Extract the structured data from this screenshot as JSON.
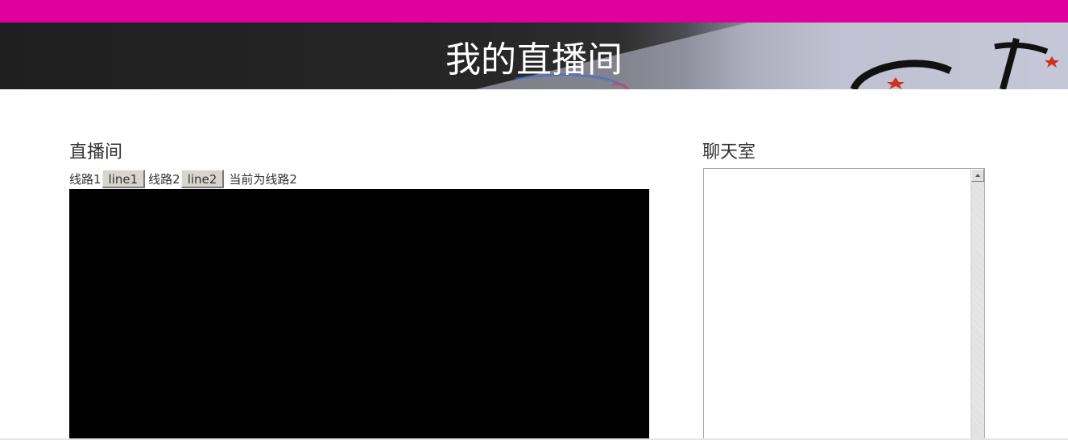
{
  "colors": {
    "topbar": "#e0009c",
    "banner_text": "#ffffff",
    "video_background": "#000000",
    "button_face": "#d8d5cf"
  },
  "banner": {
    "title": "我的直播间"
  },
  "live": {
    "heading": "直播间",
    "routes": [
      {
        "label": "线路1",
        "button_label": "line1"
      },
      {
        "label": "线路2",
        "button_label": "line2"
      }
    ],
    "status_text": "当前为线路2"
  },
  "chat": {
    "heading": "聊天室",
    "value": ""
  },
  "icons": {
    "scroll_up": "scroll-up-arrow-icon"
  }
}
